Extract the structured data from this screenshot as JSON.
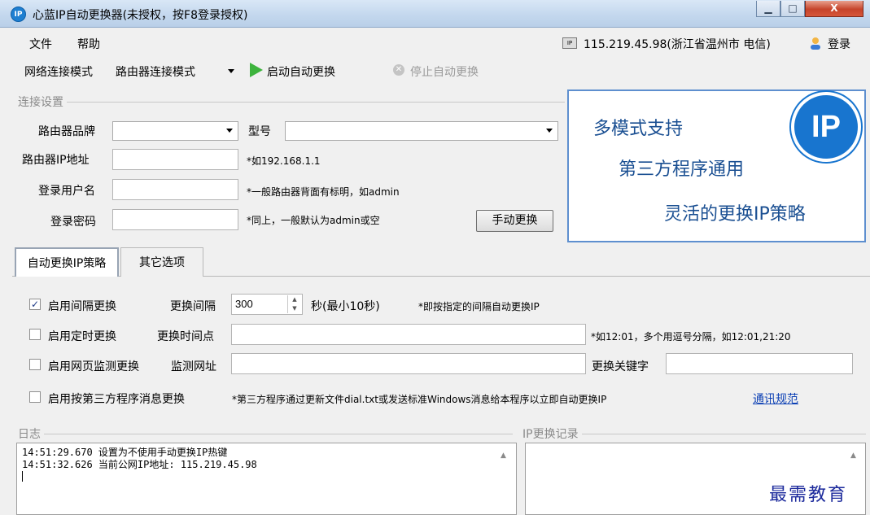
{
  "window": {
    "title": "心蓝IP自动更换器(未授权，按F8登录授权)",
    "app_icon": "ip-logo-icon",
    "controls": {
      "minimize": "▁",
      "maximize": "□",
      "close": "X"
    }
  },
  "menu": {
    "file": "文件",
    "help": "帮助"
  },
  "status": {
    "network_icon": "network-card-icon",
    "ip_info": "115.219.45.98(浙江省温州市 电信)",
    "login_icon": "user-icon",
    "login_label": "登录"
  },
  "toolbar": {
    "mode_label": "网络连接模式",
    "mode_value": "路由器连接模式",
    "start_label": "启动自动更换",
    "stop_label": "停止自动更换"
  },
  "connection": {
    "group_title": "连接设置",
    "brand_label": "路由器品牌",
    "brand_value": "",
    "model_label": "型号",
    "model_value": "",
    "ip_label": "路由器IP地址",
    "ip_value": "",
    "ip_hint": "*如192.168.1.1",
    "user_label": "登录用户名",
    "user_value": "",
    "user_hint": "*一般路由器背面有标明，如admin",
    "pass_label": "登录密码",
    "pass_value": "",
    "pass_hint": "*同上，一般默认为admin或空",
    "manual_button": "手动更换"
  },
  "banner": {
    "line1": "多模式支持",
    "line2": "第三方程序通用",
    "line3": "灵活的更换IP策略",
    "logo_text": "IP"
  },
  "tabs": [
    {
      "label": "自动更换IP策略"
    },
    {
      "label": "其它选项"
    }
  ],
  "strategy": {
    "interval_enable": "启用间隔更换",
    "interval_checked": true,
    "interval_label": "更换间隔",
    "interval_value": "300",
    "interval_unit": "秒(最小10秒)",
    "interval_hint": "*即按指定的间隔自动更换IP",
    "timed_enable": "启用定时更换",
    "timed_label": "更换时间点",
    "timed_value": "",
    "timed_hint": "*如12:01，多个用逗号分隔，如12:01,21:20",
    "web_enable": "启用网页监测更换",
    "web_label": "监测网址",
    "web_value": "",
    "web_keyword_label": "更换关键字",
    "web_keyword_value": "",
    "third_enable": "启用按第三方程序消息更换",
    "third_hint": "*第三方程序通过更新文件dial.txt或发送标准Windows消息给本程序以立即自动更换IP",
    "third_link": "通讯规范"
  },
  "log": {
    "title": "日志",
    "lines": [
      "14:51:29.670 设置为不使用手动更换IP热键",
      "14:51:32.626 当前公网IP地址: 115.219.45.98"
    ]
  },
  "ip_history": {
    "title": "IP更换记录"
  },
  "watermark": "最需教育"
}
